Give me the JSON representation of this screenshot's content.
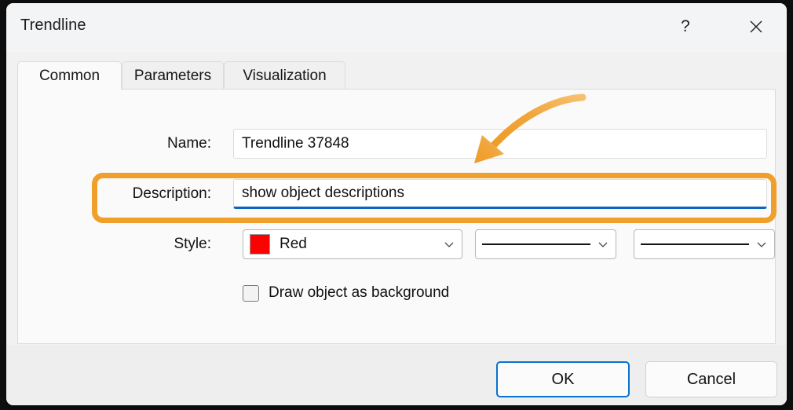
{
  "window": {
    "title": "Trendline",
    "help_icon": "question-mark-icon",
    "close_icon": "close-icon"
  },
  "tabs": [
    {
      "label": "Common",
      "active": true
    },
    {
      "label": "Parameters",
      "active": false
    },
    {
      "label": "Visualization",
      "active": false
    }
  ],
  "form": {
    "name": {
      "label": "Name:",
      "value": "Trendline 37848"
    },
    "description": {
      "label": "Description:",
      "value": "show object descriptions",
      "focused": true,
      "focus_color": "#0a66c2"
    },
    "style": {
      "label": "Style:",
      "color_value": "Red",
      "color_hex": "#ff0000",
      "width_value": "solid-line",
      "dash_value": "solid-line"
    },
    "checkbox": {
      "label": "Draw object as background",
      "checked": false
    }
  },
  "footer": {
    "ok_label": "OK",
    "cancel_label": "Cancel",
    "ok_focus_color": "#0a72d0"
  },
  "annotations": {
    "highlight_color": "#f0a02a",
    "arrow_color": "#f0a02a",
    "arrow_target": "description-field"
  }
}
